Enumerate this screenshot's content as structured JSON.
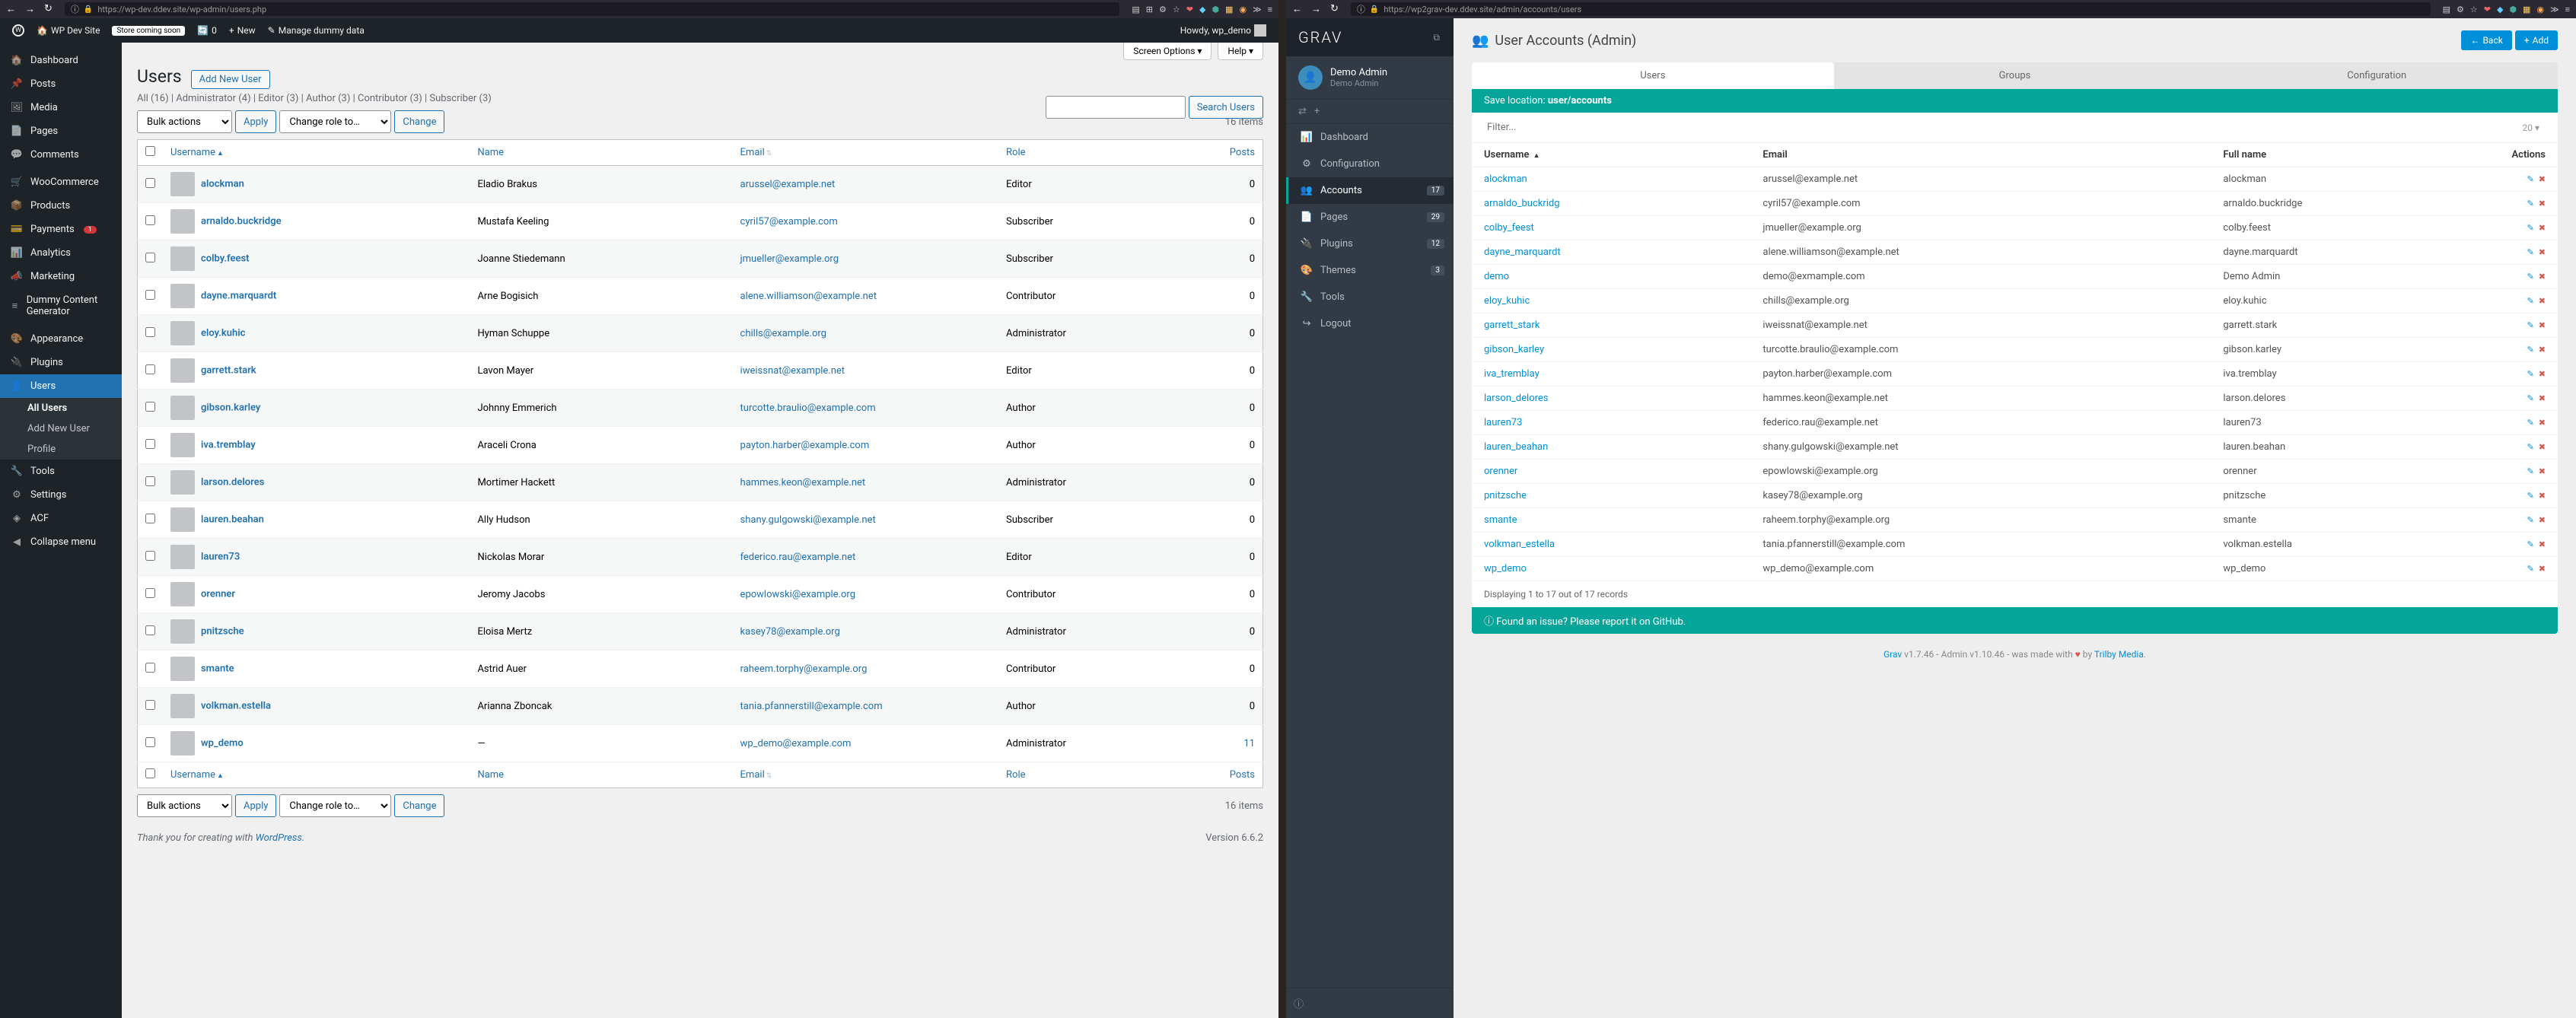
{
  "left": {
    "url": "https://wp-dev.ddev.site/wp-admin/users.php",
    "url_host": "ddev.site",
    "adminbar": {
      "site": "WP Dev Site",
      "badge": "Store coming soon",
      "comments": "0",
      "new": "New",
      "dummy": "Manage dummy data",
      "howdy": "Howdy, wp_demo"
    },
    "sidebar": {
      "items": [
        {
          "icon": "🏠",
          "label": "Dashboard",
          "name": "dashboard"
        },
        {
          "icon": "📌",
          "label": "Posts",
          "name": "posts"
        },
        {
          "icon": "🖼",
          "label": "Media",
          "name": "media"
        },
        {
          "icon": "📄",
          "label": "Pages",
          "name": "pages"
        },
        {
          "icon": "💬",
          "label": "Comments",
          "name": "comments"
        },
        {
          "icon": "🛒",
          "label": "WooCommerce",
          "name": "woocommerce"
        },
        {
          "icon": "📦",
          "label": "Products",
          "name": "products"
        },
        {
          "icon": "💳",
          "label": "Payments",
          "name": "payments",
          "badge": "1"
        },
        {
          "icon": "📊",
          "label": "Analytics",
          "name": "analytics"
        },
        {
          "icon": "📣",
          "label": "Marketing",
          "name": "marketing"
        },
        {
          "icon": "≡",
          "label": "Dummy Content Generator",
          "name": "dummy-content"
        },
        {
          "icon": "🎨",
          "label": "Appearance",
          "name": "appearance"
        },
        {
          "icon": "🔌",
          "label": "Plugins",
          "name": "plugins"
        },
        {
          "icon": "👤",
          "label": "Users",
          "name": "users",
          "current": true
        },
        {
          "icon": "🔧",
          "label": "Tools",
          "name": "tools"
        },
        {
          "icon": "⚙",
          "label": "Settings",
          "name": "settings"
        },
        {
          "icon": "◈",
          "label": "ACF",
          "name": "acf"
        },
        {
          "icon": "◀",
          "label": "Collapse menu",
          "name": "collapse"
        }
      ],
      "submenu": [
        {
          "label": "All Users",
          "current": true
        },
        {
          "label": "Add New User"
        },
        {
          "label": "Profile"
        }
      ]
    },
    "page": {
      "screen_options": "Screen Options ▾",
      "help": "Help ▾",
      "title": "Users",
      "add_new": "Add New User",
      "views": "All (16)  |  Administrator (4)  |  Editor (3)  |  Author (3)  |  Contributor (3)  |  Subscriber (3)",
      "search_btn": "Search Users",
      "bulk_label": "Bulk actions",
      "apply": "Apply",
      "change_role": "Change role to…",
      "change": "Change",
      "items_count": "16 items",
      "cols": {
        "username": "Username",
        "name": "Name",
        "email": "Email",
        "role": "Role",
        "posts": "Posts"
      },
      "rows": [
        {
          "u": "alockman",
          "n": "Eladio Brakus",
          "e": "arussel@example.net",
          "r": "Editor",
          "p": "0"
        },
        {
          "u": "arnaldo.buckridge",
          "n": "Mustafa Keeling",
          "e": "cyril57@example.com",
          "r": "Subscriber",
          "p": "0"
        },
        {
          "u": "colby.feest",
          "n": "Joanne Stiedemann",
          "e": "jmueller@example.org",
          "r": "Subscriber",
          "p": "0"
        },
        {
          "u": "dayne.marquardt",
          "n": "Arne Bogisich",
          "e": "alene.williamson@example.net",
          "r": "Contributor",
          "p": "0"
        },
        {
          "u": "eloy.kuhic",
          "n": "Hyman Schuppe",
          "e": "chills@example.org",
          "r": "Administrator",
          "p": "0"
        },
        {
          "u": "garrett.stark",
          "n": "Lavon Mayer",
          "e": "iweissnat@example.net",
          "r": "Editor",
          "p": "0"
        },
        {
          "u": "gibson.karley",
          "n": "Johnny Emmerich",
          "e": "turcotte.braulio@example.com",
          "r": "Author",
          "p": "0"
        },
        {
          "u": "iva.tremblay",
          "n": "Araceli Crona",
          "e": "payton.harber@example.com",
          "r": "Author",
          "p": "0"
        },
        {
          "u": "larson.delores",
          "n": "Mortimer Hackett",
          "e": "hammes.keon@example.net",
          "r": "Administrator",
          "p": "0"
        },
        {
          "u": "lauren.beahan",
          "n": "Ally Hudson",
          "e": "shany.gulgowski@example.net",
          "r": "Subscriber",
          "p": "0"
        },
        {
          "u": "lauren73",
          "n": "Nickolas Morar",
          "e": "federico.rau@example.net",
          "r": "Editor",
          "p": "0"
        },
        {
          "u": "orenner",
          "n": "Jeromy Jacobs",
          "e": "epowlowski@example.org",
          "r": "Contributor",
          "p": "0"
        },
        {
          "u": "pnitzsche",
          "n": "Eloisa Mertz",
          "e": "kasey78@example.org",
          "r": "Administrator",
          "p": "0"
        },
        {
          "u": "smante",
          "n": "Astrid Auer",
          "e": "raheem.torphy@example.org",
          "r": "Contributor",
          "p": "0"
        },
        {
          "u": "volkman.estella",
          "n": "Arianna Zboncak",
          "e": "tania.pfannerstill@example.com",
          "r": "Author",
          "p": "0"
        },
        {
          "u": "wp_demo",
          "n": "—",
          "e": "wp_demo@example.com",
          "r": "Administrator",
          "p": "11",
          "plink": true
        }
      ],
      "footer_thank": "Thank you for creating with ",
      "footer_wp": "WordPress",
      "footer_dot": ".",
      "version": "Version 6.6.2"
    }
  },
  "right": {
    "url": "https://wp2grav-dev.ddev.site/admin/accounts/users",
    "logo": "GRAV",
    "user": {
      "name": "Demo Admin",
      "sub": "Demo Admin"
    },
    "menu": [
      {
        "icon": "📊",
        "label": "Dashboard",
        "name": "dashboard"
      },
      {
        "icon": "⚙",
        "label": "Configuration",
        "name": "configuration"
      },
      {
        "icon": "👥",
        "label": "Accounts",
        "name": "accounts",
        "badge": "17",
        "active": true
      },
      {
        "icon": "📄",
        "label": "Pages",
        "name": "pages",
        "badge": "29"
      },
      {
        "icon": "🔌",
        "label": "Plugins",
        "name": "plugins",
        "badge": "12"
      },
      {
        "icon": "🎨",
        "label": "Themes",
        "name": "themes",
        "badge": "3"
      },
      {
        "icon": "🔧",
        "label": "Tools",
        "name": "tools"
      },
      {
        "icon": "↪",
        "label": "Logout",
        "name": "logout"
      }
    ],
    "page": {
      "title": "User Accounts (Admin)",
      "back": "Back",
      "add": "Add",
      "tabs": [
        "Users",
        "Groups",
        "Configuration"
      ],
      "save_location_label": "Save location: ",
      "save_location_path": "user/accounts",
      "filter_placeholder": "Filter...",
      "page_size": "20",
      "cols": {
        "username": "Username",
        "email": "Email",
        "fullname": "Full name",
        "actions": "Actions"
      },
      "rows": [
        {
          "u": "alockman",
          "e": "arussel@example.net",
          "f": "alockman"
        },
        {
          "u": "arnaldo_buckridg",
          "e": "cyril57@example.com",
          "f": "arnaldo.buckridge"
        },
        {
          "u": "colby_feest",
          "e": "jmueller@example.org",
          "f": "colby.feest"
        },
        {
          "u": "dayne_marquardt",
          "e": "alene.williamson@example.net",
          "f": "dayne.marquardt"
        },
        {
          "u": "demo",
          "e": "demo@exmample.com",
          "f": "Demo Admin"
        },
        {
          "u": "eloy_kuhic",
          "e": "chills@example.org",
          "f": "eloy.kuhic"
        },
        {
          "u": "garrett_stark",
          "e": "iweissnat@example.net",
          "f": "garrett.stark"
        },
        {
          "u": "gibson_karley",
          "e": "turcotte.braulio@example.com",
          "f": "gibson.karley"
        },
        {
          "u": "iva_tremblay",
          "e": "payton.harber@example.com",
          "f": "iva.tremblay"
        },
        {
          "u": "larson_delores",
          "e": "hammes.keon@example.net",
          "f": "larson.delores"
        },
        {
          "u": "lauren73",
          "e": "federico.rau@example.net",
          "f": "lauren73"
        },
        {
          "u": "lauren_beahan",
          "e": "shany.gulgowski@example.net",
          "f": "lauren.beahan"
        },
        {
          "u": "orenner",
          "e": "epowlowski@example.org",
          "f": "orenner"
        },
        {
          "u": "pnitzsche",
          "e": "kasey78@example.org",
          "f": "pnitzsche"
        },
        {
          "u": "smante",
          "e": "raheem.torphy@example.org",
          "f": "smante"
        },
        {
          "u": "volkman_estella",
          "e": "tania.pfannerstill@example.com",
          "f": "volkman.estella"
        },
        {
          "u": "wp_demo",
          "e": "wp_demo@example.com",
          "f": "wp_demo"
        }
      ],
      "displaying": "Displaying 1 to 17 out of 17 records",
      "issue": "Found an issue? Please report it on GitHub.",
      "footer_grav": "Grav",
      "footer_v": " v1.7.46 - Admin v1.10.46 - was made with ",
      "footer_by": " by ",
      "footer_trilby": "Trilby Media",
      "footer_dot": "."
    }
  }
}
